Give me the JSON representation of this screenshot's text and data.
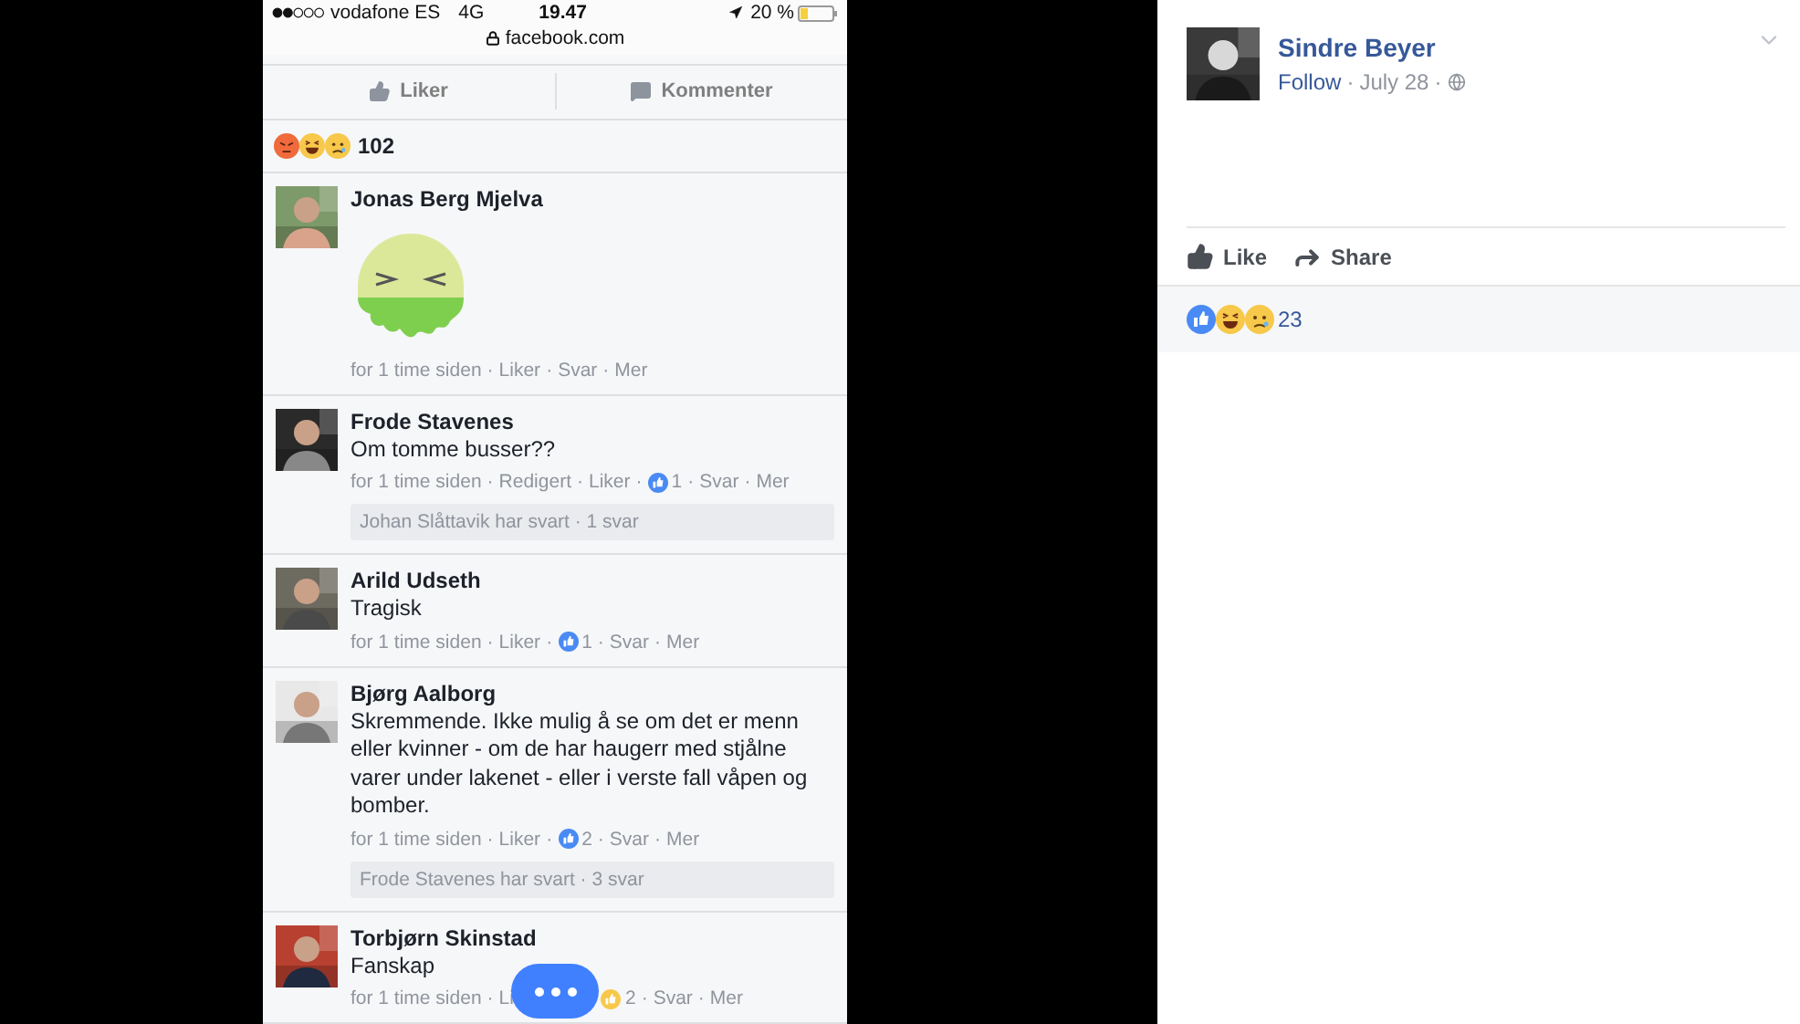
{
  "status_bar": {
    "carrier": "vodafone ES",
    "network": "4G",
    "time": "19.47",
    "battery": "20 %"
  },
  "address_bar": {
    "url": "facebook.com"
  },
  "post_actions": [
    "Liker",
    "Kommenter"
  ],
  "reactions_count": "102",
  "separator": "·",
  "comments": [
    {
      "name": "Jonas Berg Mjelva",
      "kind": "sticker",
      "meta": [
        {
          "kind": "text",
          "text": "for 1 time siden"
        },
        {
          "kind": "link",
          "text": "Liker"
        },
        {
          "kind": "link",
          "text": "Svar"
        },
        {
          "kind": "link",
          "text": "Mer"
        }
      ]
    },
    {
      "name": "Frode Stavenes",
      "kind": "text",
      "text": "Om tomme busser??",
      "meta": [
        {
          "kind": "text",
          "text": "for 1 time siden"
        },
        {
          "kind": "text",
          "text": "Redigert"
        },
        {
          "kind": "link",
          "text": "Liker"
        },
        {
          "kind": "likes",
          "text": "1",
          "color": "#4a8af4"
        },
        {
          "kind": "link",
          "text": "Svar"
        },
        {
          "kind": "link",
          "text": "Mer"
        }
      ],
      "replies": "Johan Slåttavik har svart · 1 svar"
    },
    {
      "name": "Arild Udseth",
      "kind": "text",
      "text": "Tragisk",
      "meta": [
        {
          "kind": "text",
          "text": "for 1 time siden"
        },
        {
          "kind": "link",
          "text": "Liker"
        },
        {
          "kind": "likes",
          "text": "1",
          "color": "#4a8af4"
        },
        {
          "kind": "link",
          "text": "Svar"
        },
        {
          "kind": "link",
          "text": "Mer"
        }
      ]
    },
    {
      "name": "Bjørg Aalborg",
      "kind": "text",
      "text": "Skremmende. Ikke mulig å se om det er menn eller kvinner - om de har haugerr med stjålne varer under lakenet - eller i verste fall våpen og bomber.",
      "meta": [
        {
          "kind": "text",
          "text": "for 1 time siden"
        },
        {
          "kind": "link",
          "text": "Liker"
        },
        {
          "kind": "likes",
          "text": "2",
          "color": "#4a8af4"
        },
        {
          "kind": "link",
          "text": "Svar"
        },
        {
          "kind": "link",
          "text": "Mer"
        }
      ],
      "replies": "Frode Stavenes har svart · 3 svar"
    },
    {
      "name": "Torbjørn Skinstad",
      "kind": "text",
      "text": "Fanskap",
      "meta": [
        {
          "kind": "text",
          "text": "for 1 time siden"
        },
        {
          "kind": "link",
          "text": "Li"
        },
        {
          "kind": "covered"
        },
        {
          "kind": "likes",
          "text": "2",
          "color": "#f7c84a"
        },
        {
          "kind": "link",
          "text": "Svar"
        },
        {
          "kind": "link",
          "text": "Mer"
        }
      ]
    }
  ],
  "desktop_post": {
    "author": "Sindre Beyer",
    "follow": "Follow",
    "date": "July 28",
    "actions": [
      "Like",
      "Share"
    ],
    "reactions_count": "23"
  }
}
